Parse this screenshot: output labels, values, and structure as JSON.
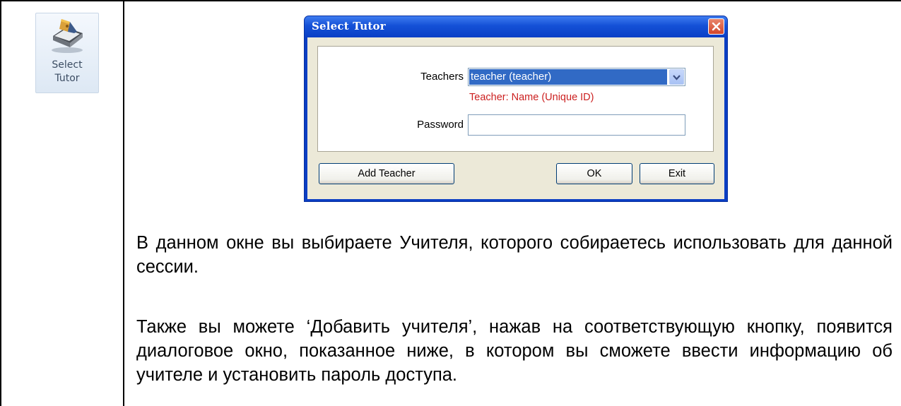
{
  "ribbon": {
    "button_label": "Select Tutor",
    "icon": "tutor-book-icon"
  },
  "dialog": {
    "title": "Select Tutor",
    "close_icon": "close-icon",
    "teachers_label": "Teachers",
    "teachers_selected": "teacher (teacher)",
    "teachers_hint": "Teacher: Name (Unique ID)",
    "password_label": "Password",
    "password_value": "",
    "add_teacher_button": "Add Teacher",
    "ok_button": "OK",
    "exit_button": "Exit",
    "colors": {
      "title_bar": "#0b3ec3",
      "selection": "#316ac5",
      "hint_text": "#cc2020"
    }
  },
  "text": {
    "paragraph1": "В данном окне вы выбираете Учителя, которого собираетесь использовать для данной сессии.",
    "paragraph2": "Также вы можете ‘Добавить учителя’, нажав на соответствующую кнопку, появится диалоговое окно, показанное ниже, в котором вы сможете ввести информацию об учителе и установить пароль доступа."
  }
}
